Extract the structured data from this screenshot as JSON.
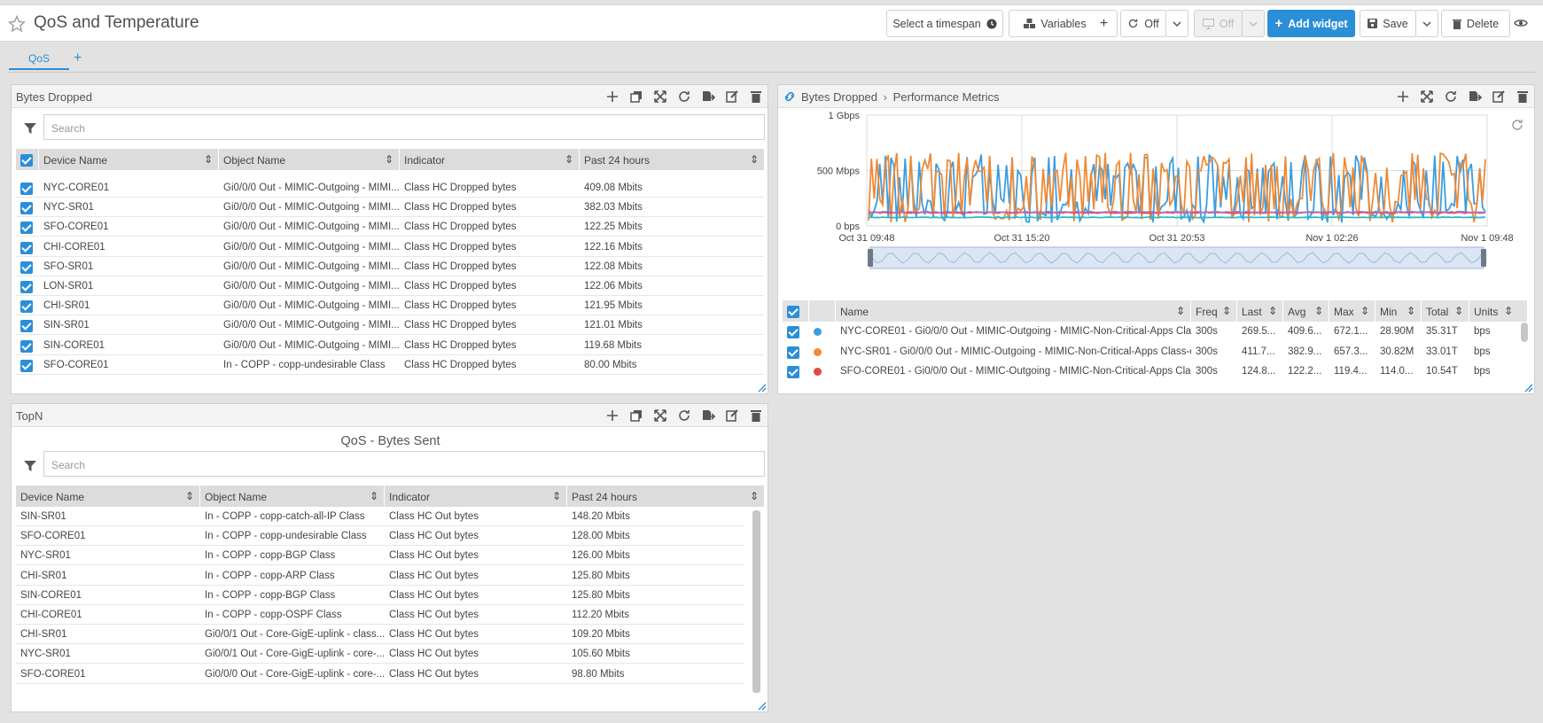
{
  "header": {
    "title": "QoS and Temperature",
    "timespan": "Select a timespan",
    "variables": "Variables",
    "refresh_off": "Off",
    "display_off": "Off",
    "add_widget": "Add widget",
    "save": "Save",
    "delete": "Delete"
  },
  "tabs": [
    {
      "label": "QoS"
    }
  ],
  "bytes_dropped": {
    "title": "Bytes Dropped",
    "search_placeholder": "Search",
    "columns": [
      "Device Name",
      "Object Name",
      "Indicator",
      "Past 24 hours"
    ],
    "rows": [
      [
        "NYC-CORE01",
        "Gi0/0/0 Out - MIMIC-Outgoing - MIMI...",
        "Class HC Dropped bytes",
        "409.08 Mbits"
      ],
      [
        "NYC-SR01",
        "Gi0/0/0 Out - MIMIC-Outgoing - MIMI...",
        "Class HC Dropped bytes",
        "382.03 Mbits"
      ],
      [
        "SFO-CORE01",
        "Gi0/0/0 Out - MIMIC-Outgoing - MIMI...",
        "Class HC Dropped bytes",
        "122.25 Mbits"
      ],
      [
        "CHI-CORE01",
        "Gi0/0/0 Out - MIMIC-Outgoing - MIMI...",
        "Class HC Dropped bytes",
        "122.16 Mbits"
      ],
      [
        "SFO-SR01",
        "Gi0/0/0 Out - MIMIC-Outgoing - MIMI...",
        "Class HC Dropped bytes",
        "122.08 Mbits"
      ],
      [
        "LON-SR01",
        "Gi0/0/0 Out - MIMIC-Outgoing - MIMI...",
        "Class HC Dropped bytes",
        "122.06 Mbits"
      ],
      [
        "CHI-SR01",
        "Gi0/0/0 Out - MIMIC-Outgoing - MIMI...",
        "Class HC Dropped bytes",
        "121.95 Mbits"
      ],
      [
        "SIN-SR01",
        "Gi0/0/0 Out - MIMIC-Outgoing - MIMI...",
        "Class HC Dropped bytes",
        "121.01 Mbits"
      ],
      [
        "SIN-CORE01",
        "Gi0/0/0 Out - MIMIC-Outgoing - MIMI...",
        "Class HC Dropped bytes",
        "119.68 Mbits"
      ],
      [
        "SFO-CORE01",
        "In - COPP - copp-undesirable Class",
        "Class HC Dropped bytes",
        "80.00 Mbits"
      ]
    ]
  },
  "topn": {
    "title": "TopN",
    "subtitle": "QoS - Bytes Sent",
    "search_placeholder": "Search",
    "columns": [
      "Device Name",
      "Object Name",
      "Indicator",
      "Past 24 hours"
    ],
    "rows": [
      [
        "SIN-SR01",
        "In - COPP - copp-catch-all-IP Class",
        "Class HC Out bytes",
        "148.20 Mbits"
      ],
      [
        "SFO-CORE01",
        "In - COPP - copp-undesirable Class",
        "Class HC Out bytes",
        "128.00 Mbits"
      ],
      [
        "NYC-SR01",
        "In - COPP - copp-BGP Class",
        "Class HC Out bytes",
        "126.00 Mbits"
      ],
      [
        "CHI-SR01",
        "In - COPP - copp-ARP Class",
        "Class HC Out bytes",
        "125.80 Mbits"
      ],
      [
        "SIN-CORE01",
        "In - COPP - copp-BGP Class",
        "Class HC Out bytes",
        "125.80 Mbits"
      ],
      [
        "CHI-CORE01",
        "In - COPP - copp-OSPF Class",
        "Class HC Out bytes",
        "112.20 Mbits"
      ],
      [
        "CHI-SR01",
        "Gi0/0/1 Out - Core-GigE-uplink - class...",
        "Class HC Out bytes",
        "109.20 Mbits"
      ],
      [
        "NYC-SR01",
        "Gi0/0/1 Out - Core-GigE-uplink - core-...",
        "Class HC Out bytes",
        "105.60 Mbits"
      ],
      [
        "SFO-CORE01",
        "Gi0/0/0 Out - Core-GigE-uplink - core-...",
        "Class HC Out bytes",
        "98.80 Mbits"
      ]
    ]
  },
  "perf": {
    "breadcrumb_parent": "Bytes Dropped",
    "breadcrumb_current": "Performance Metrics",
    "columns": [
      "Name",
      "Freq",
      "Last",
      "Avg",
      "Max",
      "Min",
      "Total",
      "Units"
    ],
    "rows": [
      {
        "color": "#3b9de0",
        "name": "NYC-CORE01 - Gi0/0/0 Out - MIMIC-Outgoing - MIMIC-Non-Critical-Apps Class...",
        "freq": "300s",
        "last": "269.5...",
        "avg": "409.6...",
        "max": "672.1...",
        "min": "28.90M",
        "total": "35.31T",
        "units": "bps"
      },
      {
        "color": "#ef8a35",
        "name": "NYC-SR01 - Gi0/0/0 Out - MIMIC-Outgoing - MIMIC-Non-Critical-Apps Class-cl...",
        "freq": "300s",
        "last": "411.7...",
        "avg": "382.9...",
        "max": "657.3...",
        "min": "30.82M",
        "total": "33.01T",
        "units": "bps"
      },
      {
        "color": "#e04848",
        "name": "SFO-CORE01 - Gi0/0/0 Out - MIMIC-Outgoing - MIMIC-Non-Critical-Apps Class...",
        "freq": "300s",
        "last": "124.8...",
        "avg": "122.2...",
        "max": "119.4...",
        "min": "114.0...",
        "total": "10.54T",
        "units": "bps"
      }
    ]
  },
  "chart_data": {
    "type": "line",
    "ytick_labels": [
      "1 Gbps",
      "500 Mbps",
      "0 bps"
    ],
    "xtick_labels": [
      "Oct 31 09:48",
      "Oct 31 15:20",
      "Oct 31 20:53",
      "Nov 1 02:26",
      "Nov 1 09:48"
    ],
    "ylim_mbps": [
      0,
      1000
    ],
    "grid": true,
    "series": [
      {
        "color": "#3b9de0",
        "approx_range_mbps": [
          30,
          650
        ]
      },
      {
        "color": "#ef8a35",
        "approx_range_mbps": [
          30,
          660
        ]
      },
      {
        "color": "#e04848",
        "approx_range_mbps": [
          115,
          125
        ]
      },
      {
        "color": "#2bb8c8",
        "approx_range_mbps": [
          75,
          80
        ]
      },
      {
        "color": "#b070c0",
        "approx_range_mbps": [
          120,
          130
        ]
      }
    ]
  }
}
